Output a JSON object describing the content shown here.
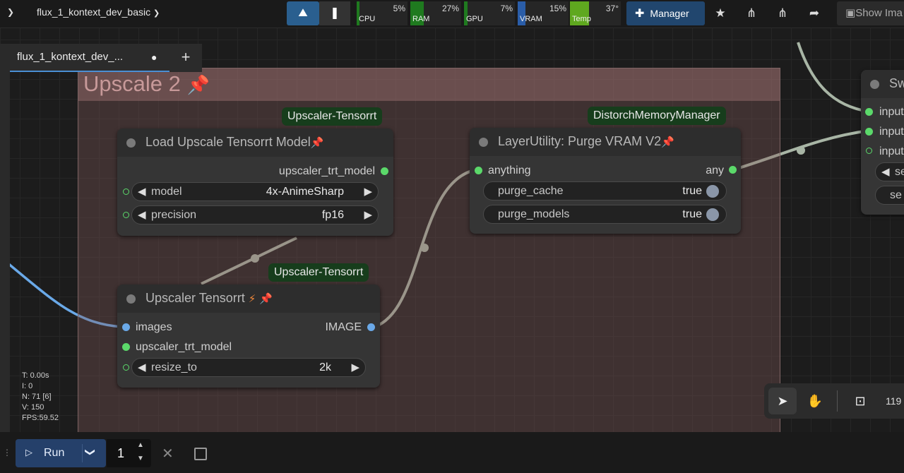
{
  "topbar": {
    "workflow_title": "flux_1_kontext_dev_basic",
    "monitors": [
      {
        "label": "CPU",
        "value": "5%",
        "fill": 0.05,
        "color": "#1f7a1f"
      },
      {
        "label": "RAM",
        "value": "27%",
        "fill": 0.27,
        "color": "#1f7a1f"
      },
      {
        "label": "GPU",
        "value": "7%",
        "fill": 0.07,
        "color": "#1f7a1f"
      },
      {
        "label": "VRAM",
        "value": "15%",
        "fill": 0.15,
        "color": "#2a5da8"
      },
      {
        "label": "Temp",
        "value": "37°",
        "fill": 0.37,
        "color": "#5fa81f"
      }
    ],
    "manager_label": "Manager",
    "show_image_label": "Show Ima"
  },
  "tabs": [
    {
      "label": "flux_1_kontext_dev_...",
      "modified": "●"
    }
  ],
  "group": {
    "title": "Upscale 2",
    "pin_icon": "📌"
  },
  "nodes": {
    "load_model": {
      "badge": "Upscaler-Tensorrt",
      "title": "Load Upscale Tensorrt Model",
      "output": "upscaler_trt_model",
      "widgets": [
        {
          "label": "model",
          "value": "4x-AnimeSharp"
        },
        {
          "label": "precision",
          "value": "fp16"
        }
      ]
    },
    "purge": {
      "badge": "DistorchMemoryManager",
      "title": "LayerUtility: Purge VRAM V2",
      "input": "anything",
      "output": "any",
      "widgets": [
        {
          "label": "purge_cache",
          "value": "true"
        },
        {
          "label": "purge_models",
          "value": "true"
        }
      ]
    },
    "upscaler": {
      "badge": "Upscaler-Tensorrt",
      "title": "Upscaler Tensorrt",
      "inputs": [
        "images",
        "upscaler_trt_model"
      ],
      "output": "IMAGE",
      "widgets": [
        {
          "label": "resize_to",
          "value": "2k"
        }
      ]
    },
    "partial": {
      "title": "Sw",
      "inputs": [
        "input",
        "input",
        "input"
      ],
      "widgets": [
        "se",
        "se"
      ]
    }
  },
  "stats": {
    "t": "T: 0.00s",
    "i": "I: 0",
    "n": "N: 71 [6]",
    "v": "V: 150",
    "fps": "FPS:59.52"
  },
  "zoom": "119",
  "bottombar": {
    "run_label": "Run",
    "queue_count": "1"
  }
}
